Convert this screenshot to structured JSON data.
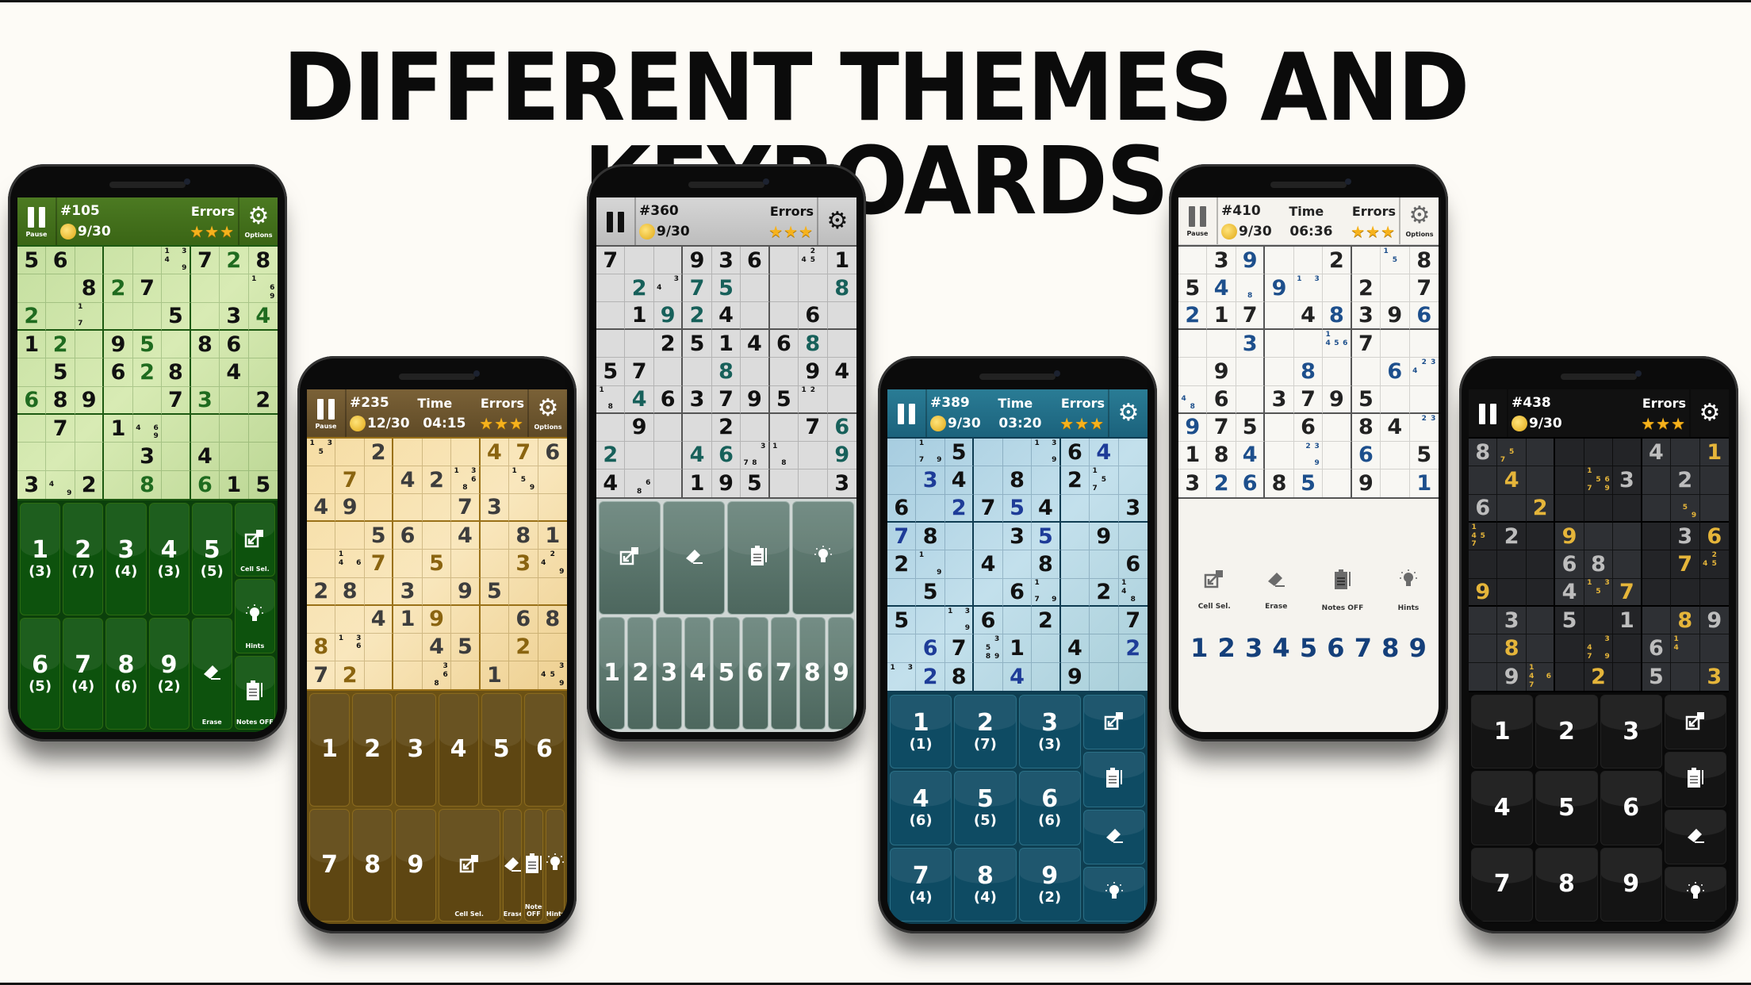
{
  "headline": "DIFFERENT THEMES AND KEYBOARDS",
  "labels": {
    "pause": "Pause",
    "options": "Options",
    "time": "Time",
    "errors": "Errors",
    "cell_sel": "Cell Sel.",
    "erase": "Erase",
    "notes": "Notes OFF",
    "hints": "Hints"
  },
  "icons": {
    "pause": "pause-icon",
    "gear": "gear-icon",
    "coin": "coin-icon",
    "star": "star-icon",
    "cell_select": "cell-select-icon",
    "erase": "eraser-icon",
    "notes": "clipboard-notes-icon",
    "hint": "lightbulb-icon"
  },
  "phones": [
    {
      "theme": "green",
      "puzzle": "#105",
      "coins": "9/30",
      "time": null,
      "stars": 3,
      "show_labels": true,
      "colors": {
        "given": "#111111",
        "user": "#1f6b1f",
        "note": "#111111"
      },
      "grid": [
        [
          "5",
          "6",
          "",
          "",
          "",
          "n:1,3,4,9",
          "7",
          "u2",
          "8"
        ],
        [
          "",
          "",
          "8",
          "u2",
          "7",
          "",
          "",
          "",
          "n:1,6,9"
        ],
        [
          "u2",
          "",
          "n:1,7",
          "",
          "",
          "5",
          "",
          "3",
          "u4"
        ],
        [
          "1",
          "u2",
          "",
          "9",
          "u5",
          "",
          "8",
          "6",
          ""
        ],
        [
          "",
          "5",
          "",
          "6",
          "u2",
          "8",
          "",
          "4",
          ""
        ],
        [
          "u6",
          "8",
          "9",
          "",
          "",
          "7",
          "u3",
          "",
          "2"
        ],
        [
          "",
          "7",
          "",
          "1",
          "n:4,6,9",
          "",
          "",
          "",
          ""
        ],
        [
          "",
          "",
          "",
          "",
          "3",
          "",
          "4",
          "",
          ""
        ],
        [
          "3",
          "n:4,9",
          "2",
          "",
          "u8",
          "",
          "u6",
          "1",
          "5"
        ]
      ],
      "keyboard": {
        "digits": [
          {
            "d": "1",
            "c": "(3)"
          },
          {
            "d": "2",
            "c": "(7)"
          },
          {
            "d": "3",
            "c": "(4)"
          },
          {
            "d": "4",
            "c": "(3)"
          },
          {
            "d": "5",
            "c": "(5)"
          },
          {
            "d": "6",
            "c": "(5)"
          },
          {
            "d": "7",
            "c": "(4)"
          },
          {
            "d": "8",
            "c": "(6)"
          },
          {
            "d": "9",
            "c": "(2)"
          }
        ]
      }
    },
    {
      "theme": "gold",
      "puzzle": "#235",
      "coins": "12/30",
      "time": "04:15",
      "stars": 3,
      "show_labels": true,
      "colors": {
        "given": "#3d3d3d",
        "user": "#8a6410",
        "note": "#111111"
      },
      "grid": [
        [
          "n:1,3,5",
          "",
          "2",
          "",
          "",
          "",
          "u4",
          "u7",
          "6"
        ],
        [
          "",
          "u7",
          "",
          "4",
          "2",
          "n:1,3,6,8",
          "",
          "n:1,5,9",
          ""
        ],
        [
          "4",
          "9",
          "",
          "",
          "",
          "7",
          "3",
          "",
          ""
        ],
        [
          "",
          "",
          "5",
          "6",
          "",
          "4",
          "",
          "8",
          "1"
        ],
        [
          "",
          "n:1,4,6",
          "u7",
          "",
          "u5",
          "",
          "",
          "u3",
          "n:2,4,9"
        ],
        [
          "2",
          "8",
          "",
          "3",
          "",
          "9",
          "5",
          "",
          ""
        ],
        [
          "",
          "",
          "4",
          "1",
          "u9",
          "",
          "",
          "6",
          "8"
        ],
        [
          "u8",
          "n:1,3,6",
          "",
          "",
          "4",
          "5",
          "",
          "u2",
          ""
        ],
        [
          "7",
          "u2",
          "",
          "",
          "n:3,6,8",
          "",
          "1",
          "",
          "n:3,4,5,9"
        ]
      ],
      "keyboard": {
        "digits": [
          "1",
          "2",
          "3",
          "4",
          "5",
          "6",
          "7",
          "8",
          "9"
        ]
      }
    },
    {
      "theme": "gray",
      "puzzle": "#360",
      "coins": "9/30",
      "time": null,
      "stars": 3,
      "show_labels": false,
      "colors": {
        "given": "#111111",
        "user": "#17605a",
        "note": "#111111"
      },
      "grid": [
        [
          "7",
          "",
          "",
          "9",
          "3",
          "6",
          "",
          "n:2,4,5",
          "1"
        ],
        [
          "",
          "u2",
          "n:3,4",
          "u7",
          "u5",
          "",
          "",
          "",
          "u8"
        ],
        [
          "",
          "1",
          "u9",
          "u2",
          "4",
          "",
          "",
          "6",
          ""
        ],
        [
          "",
          "",
          "2",
          "5",
          "1",
          "4",
          "6",
          "u8",
          ""
        ],
        [
          "5",
          "7",
          "",
          "",
          "u8",
          "",
          "",
          "9",
          "4"
        ],
        [
          "n:1,8",
          "u4",
          "6",
          "3",
          "7",
          "9",
          "5",
          "n:1,2",
          ""
        ],
        [
          "",
          "9",
          "",
          "",
          "2",
          "",
          "",
          "7",
          "u6"
        ],
        [
          "u2",
          "",
          "",
          "u4",
          "u6",
          "n:3,7,8",
          "n:1,8",
          "",
          "u9"
        ],
        [
          "4",
          "n:6,8",
          "",
          "1",
          "9",
          "5",
          "",
          "",
          "3"
        ]
      ],
      "keyboard": {
        "digits": [
          "1",
          "2",
          "3",
          "4",
          "5",
          "6",
          "7",
          "8",
          "9"
        ]
      }
    },
    {
      "theme": "blue",
      "puzzle": "#389",
      "coins": "9/30",
      "time": "03:20",
      "stars": 3,
      "show_labels": false,
      "colors": {
        "given": "#111111",
        "user": "#1e3c98",
        "note": "#111111"
      },
      "grid": [
        [
          "",
          "n:1,7,9",
          "5",
          "",
          "",
          "n:1,3,9",
          "6",
          "u4",
          ""
        ],
        [
          "",
          "u3",
          "4",
          "",
          "8",
          "",
          "2",
          "n:1,5,7",
          ""
        ],
        [
          "6",
          "",
          "u2",
          "7",
          "u5",
          "4",
          "",
          "",
          "3"
        ],
        [
          "u7",
          "8",
          "",
          "",
          "3",
          "u5",
          "",
          "9",
          ""
        ],
        [
          "2",
          "n:1,9",
          "",
          "4",
          "",
          "8",
          "",
          "",
          "6"
        ],
        [
          "",
          "5",
          "",
          "",
          "6",
          "n:1,7,9",
          "",
          "2",
          "n:1,4,8"
        ],
        [
          "5",
          "",
          "n:1,3,9",
          "6",
          "",
          "2",
          "",
          "",
          "7"
        ],
        [
          "",
          "u6",
          "7",
          "n:3,5,8,9",
          "1",
          "",
          "4",
          "",
          "u2"
        ],
        [
          "n:1,3",
          "u2",
          "8",
          "",
          "u4",
          "",
          "9",
          "",
          ""
        ]
      ],
      "keyboard": {
        "digits": [
          {
            "d": "1",
            "c": "(1)"
          },
          {
            "d": "2",
            "c": "(7)"
          },
          {
            "d": "3",
            "c": "(3)"
          },
          {
            "d": "4",
            "c": "(6)"
          },
          {
            "d": "5",
            "c": "(5)"
          },
          {
            "d": "6",
            "c": "(6)"
          },
          {
            "d": "7",
            "c": "(4)"
          },
          {
            "d": "8",
            "c": "(4)"
          },
          {
            "d": "9",
            "c": "(2)"
          }
        ]
      }
    },
    {
      "theme": "white",
      "puzzle": "#410",
      "coins": "9/30",
      "time": "06:36",
      "stars": 3,
      "show_labels": true,
      "colors": {
        "given": "#222222",
        "user": "#1d4f8c",
        "note": "#1d4f8c"
      },
      "grid": [
        [
          "",
          "3",
          "u9",
          "",
          "",
          "2",
          "",
          "n:1,5",
          "8"
        ],
        [
          "5",
          "u4",
          "n:8",
          "u9",
          "n:1,3",
          "",
          "2",
          "",
          "7"
        ],
        [
          "u2",
          "1",
          "7",
          "",
          "4",
          "u8",
          "3",
          "9",
          "u6"
        ],
        [
          "",
          "",
          "u3",
          "",
          "",
          "n:1,4,5,6",
          "7",
          "",
          ""
        ],
        [
          "",
          "9",
          "",
          "",
          "u8",
          "",
          "",
          "u6",
          "n:2,3,4"
        ],
        [
          "n:4,8",
          "6",
          "",
          "3",
          "7",
          "9",
          "5",
          "",
          ""
        ],
        [
          "u9",
          "7",
          "5",
          "",
          "6",
          "",
          "8",
          "4",
          "n:2,3"
        ],
        [
          "1",
          "8",
          "u4",
          "",
          "n:2,3,9",
          "",
          "u6",
          "",
          "5"
        ],
        [
          "3",
          "u2",
          "u6",
          "8",
          "u5",
          "",
          "9",
          "",
          "u1"
        ]
      ],
      "keyboard": {
        "digits": [
          "1",
          "2",
          "3",
          "4",
          "5",
          "6",
          "7",
          "8",
          "9"
        ],
        "digit_color": "#143f7a"
      }
    },
    {
      "theme": "dark",
      "puzzle": "#438",
      "coins": "9/30",
      "time": null,
      "stars": 3,
      "show_labels": false,
      "colors": {
        "given": "#bdbdbd",
        "user": "#e5b53a",
        "note": "#e5b53a"
      },
      "grid": [
        [
          "8",
          "n:5,7",
          "",
          "",
          "",
          "",
          "4",
          "",
          "u1"
        ],
        [
          "",
          "u4",
          "",
          "",
          "n:1,5,6,7,9",
          "3",
          "",
          "2",
          ""
        ],
        [
          "6",
          "",
          "u2",
          "",
          "",
          "",
          "",
          "n:5,9",
          ""
        ],
        [
          "n:1,4,5,7",
          "2",
          "",
          "u9",
          "",
          "",
          "",
          "3",
          "u6"
        ],
        [
          "",
          "",
          "",
          "6",
          "8",
          "",
          "",
          "u7",
          "n:2,4,5"
        ],
        [
          "u9",
          "",
          "",
          "4",
          "n:1,3,5",
          "u7",
          "",
          "",
          ""
        ],
        [
          "",
          "3",
          "",
          "5",
          "",
          "1",
          "",
          "u8",
          "9"
        ],
        [
          "",
          "u8",
          "",
          "",
          "n:3,4,7,9",
          "",
          "6",
          "n:1,4",
          ""
        ],
        [
          "",
          "9",
          "n:1,4,6,7",
          "",
          "u2",
          "",
          "5",
          "",
          "u3"
        ]
      ],
      "keyboard": {
        "digits": [
          "1",
          "2",
          "3",
          "4",
          "5",
          "6",
          "7",
          "8",
          "9"
        ]
      }
    }
  ]
}
